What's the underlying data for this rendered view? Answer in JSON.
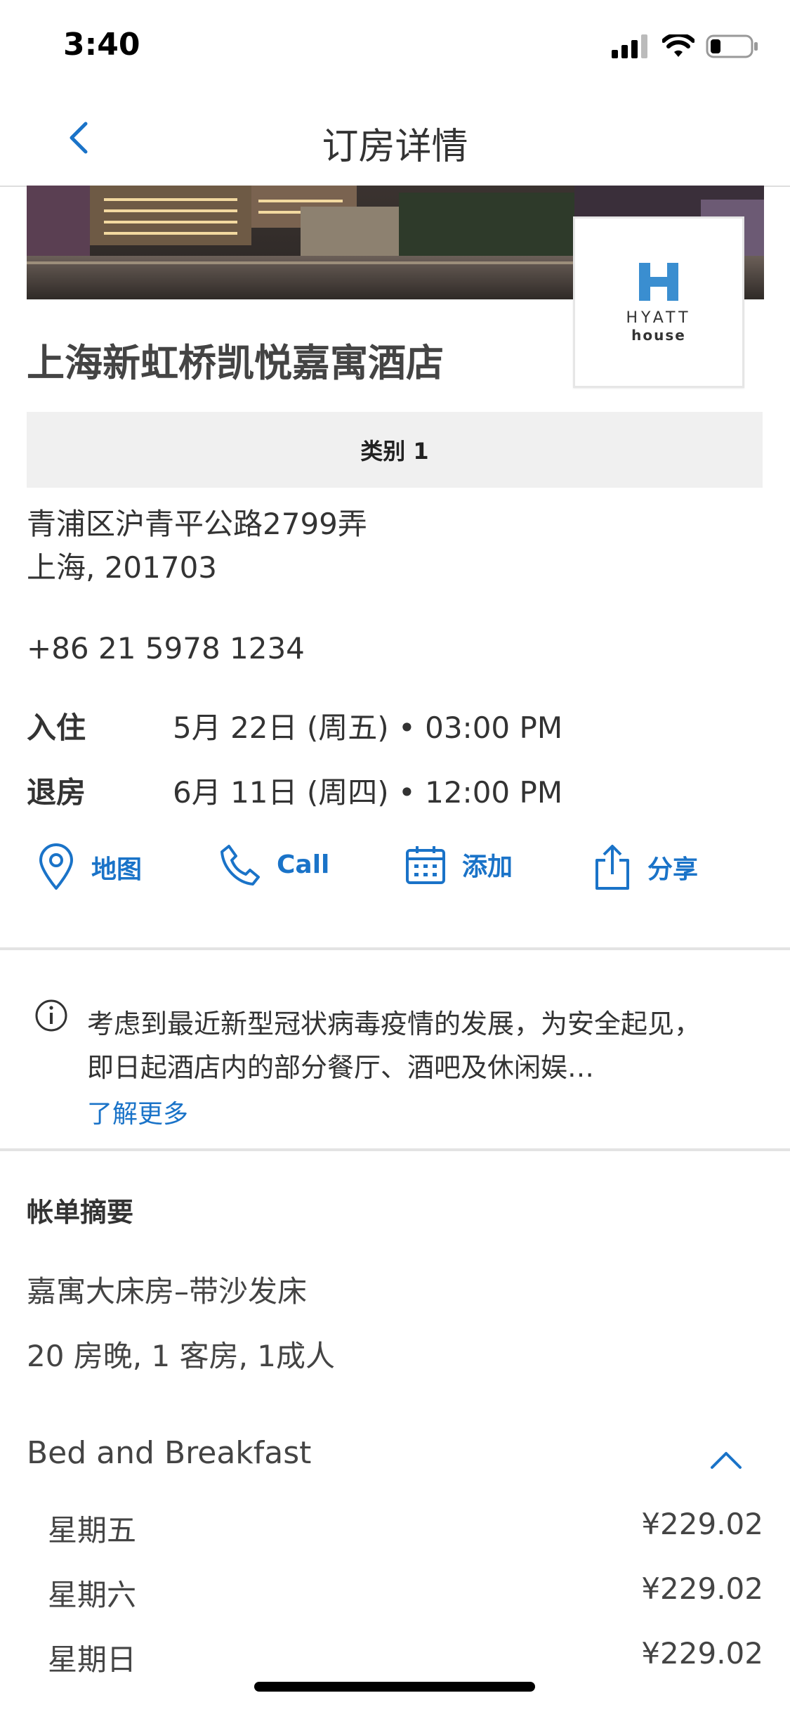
{
  "status": {
    "time": "3:40"
  },
  "nav": {
    "title": "订房详情"
  },
  "hotel": {
    "name": "上海新虹桥凯悦嘉寓酒店",
    "logo": {
      "brand": "HYATT",
      "sub": "house"
    },
    "category": "类别 1",
    "address_line1": "青浦区沪青平公路2799弄",
    "address_line2": "上海, 201703",
    "phone": "+86 21 5978 1234"
  },
  "stay": {
    "checkin_label": "入住",
    "checkin_value": "5月 22日 (周五) • 03:00 PM",
    "checkout_label": "退房",
    "checkout_value": "6月 11日 (周四) • 12:00 PM"
  },
  "actions": {
    "map": "地图",
    "call": "Call",
    "add": "添加",
    "share": "分享"
  },
  "notice": {
    "text": "考虑到最近新型冠状病毒疫情的发展，为安全起见，即日起酒店内的部分餐厅、酒吧及休闲娱…",
    "link": "了解更多"
  },
  "billing": {
    "title": "帐单摘要",
    "room": "嘉寓大床房–带沙发床",
    "summary": "20 房晚, 1 客房, 1成人",
    "rate_name": "Bed and Breakfast",
    "rows": [
      {
        "day": "星期五",
        "price": "¥229.02"
      },
      {
        "day": "星期六",
        "price": "¥229.02"
      },
      {
        "day": "星期日",
        "price": "¥229.02"
      }
    ]
  },
  "colors": {
    "accent": "#1a73c8",
    "logo_blue": "#3a8ed0"
  }
}
